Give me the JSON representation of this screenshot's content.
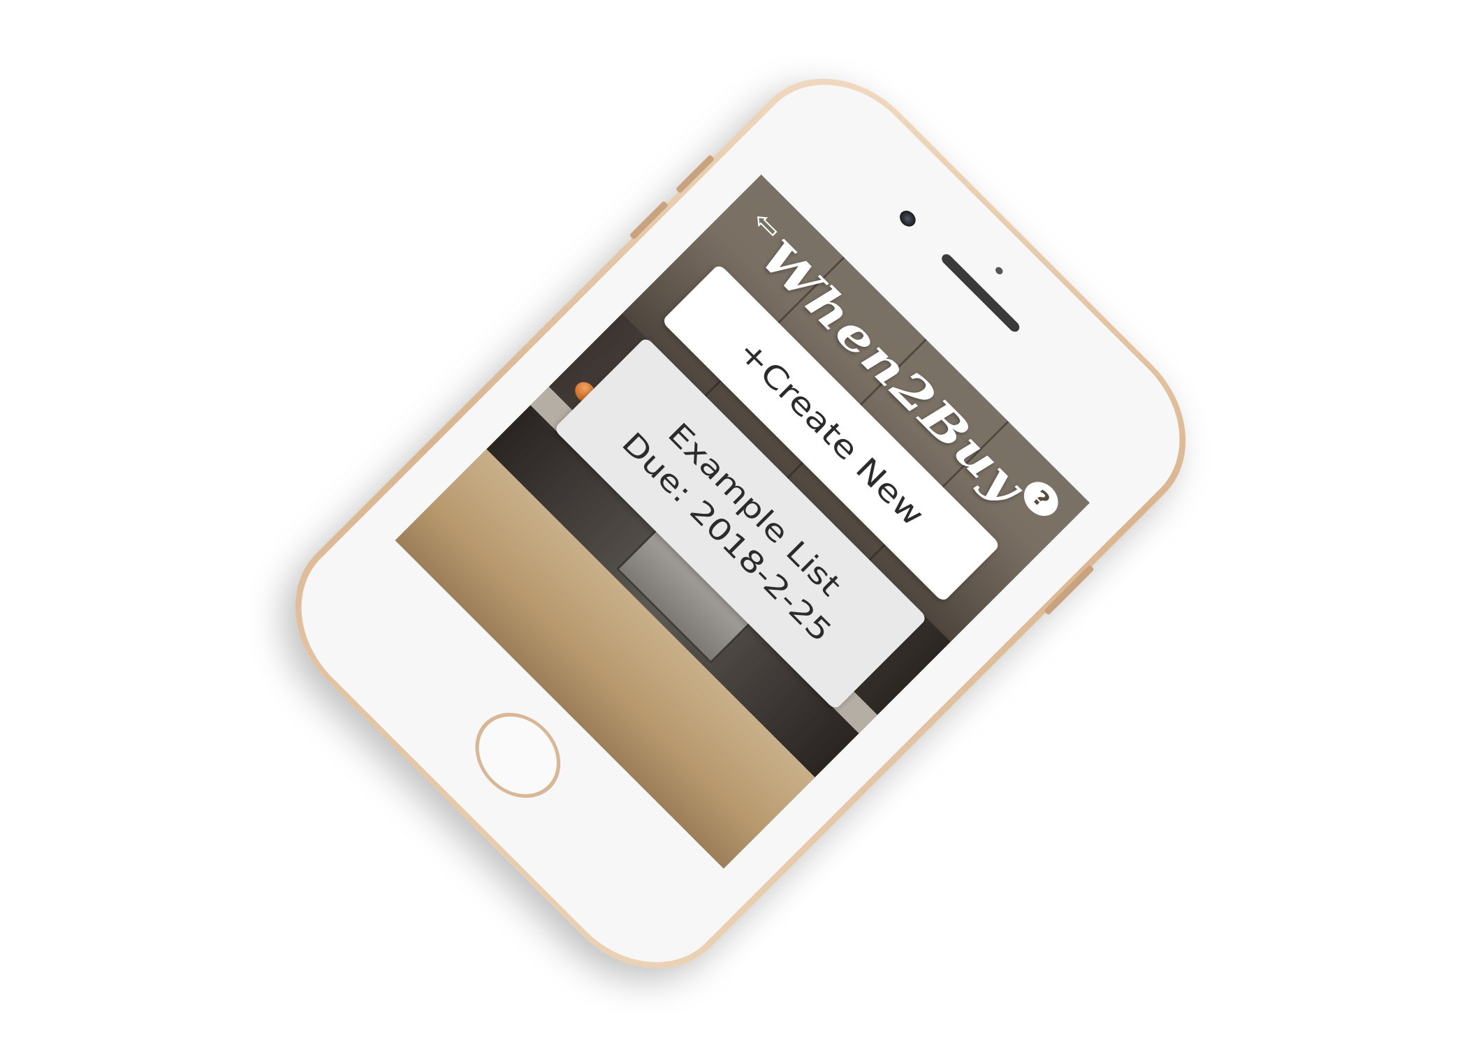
{
  "app": {
    "title": "When2Buy"
  },
  "header": {
    "back_icon": "back-icon",
    "back_glyph": "⇦",
    "help_icon": "help-icon",
    "help_glyph": "?"
  },
  "actions": {
    "create_label": "+Create New"
  },
  "lists": [
    {
      "name": "Example List",
      "due": "Due: 2018-2-25"
    }
  ],
  "colors": {
    "phone_body": "#d9b48f",
    "card": "#e9e9e9",
    "button": "#ffffff",
    "title_text": "#ffffff"
  }
}
